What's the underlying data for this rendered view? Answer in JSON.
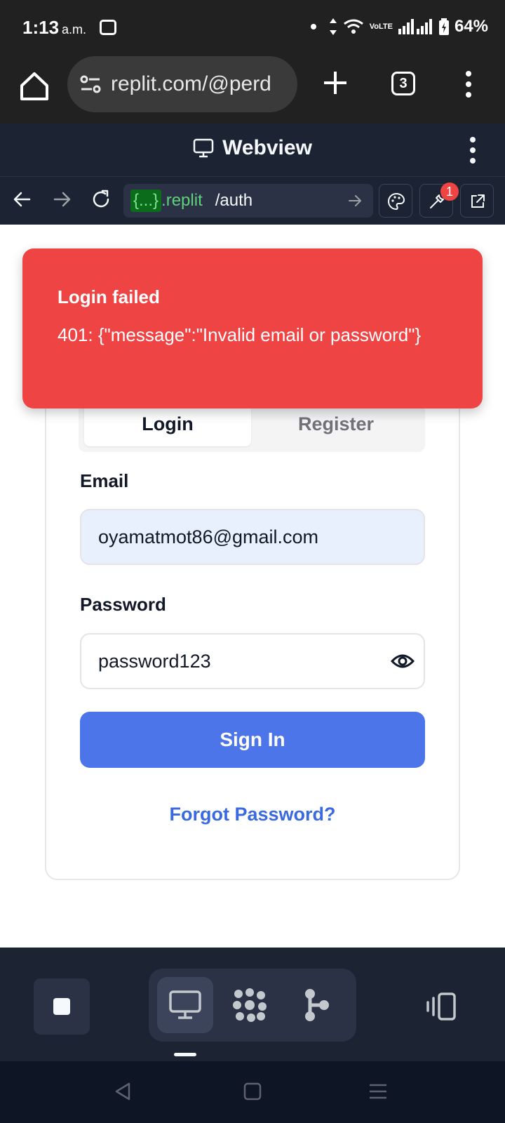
{
  "status_bar": {
    "time": "1:13",
    "ampm": "a.m.",
    "network_label": "VoLTE",
    "battery": "64%"
  },
  "browser": {
    "url": "replit.com/@perd",
    "tab_count": "3"
  },
  "webview": {
    "title": "Webview",
    "address_brace": "{...}",
    "address_domain": ".replit",
    "address_path": "/auth",
    "devtools_badge": "1"
  },
  "toast": {
    "title": "Login failed",
    "message": "401: {\"message\":\"Invalid email or password\"}",
    "color": "#ef4444"
  },
  "auth": {
    "tabs": [
      {
        "label": "Login",
        "active": true
      },
      {
        "label": "Register",
        "active": false
      }
    ],
    "email_label": "Email",
    "email_value": "oyamatmot86@gmail.com",
    "password_label": "Password",
    "password_value": "password123",
    "submit_label": "Sign In",
    "forgot_label": "Forgot Password?",
    "accent": "#4c75e9"
  },
  "replit_toolbar": {
    "items": [
      "stop-icon",
      "monitor-icon",
      "workflow-icon",
      "git-icon",
      "devices-icon"
    ]
  }
}
